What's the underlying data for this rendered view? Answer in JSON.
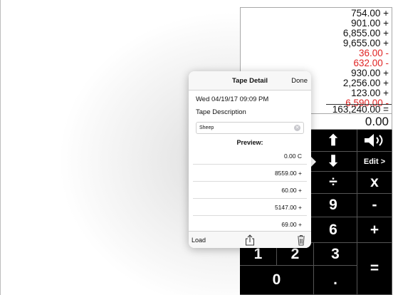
{
  "tape": {
    "lines": [
      {
        "value": "754.00 +",
        "negative": false
      },
      {
        "value": "901.00 +",
        "negative": false
      },
      {
        "value": "6,855.00 +",
        "negative": false
      },
      {
        "value": "9,655.00 +",
        "negative": false
      },
      {
        "value": "36.00 -",
        "negative": true
      },
      {
        "value": "632.00 -",
        "negative": true
      },
      {
        "value": "930.00 +",
        "negative": false
      },
      {
        "value": "2,256.00 +",
        "negative": false
      },
      {
        "value": "123.00 +",
        "negative": false
      },
      {
        "value": "6,590.00 -",
        "negative": true
      },
      {
        "value": "163,240.00 =",
        "negative": false
      }
    ],
    "negative_color": "#e02424"
  },
  "display": {
    "value": "0.00"
  },
  "keypad": {
    "up_arrow": "⬆",
    "down_arrow": "⬇",
    "sound": "🔊",
    "edit": "Edit >",
    "divide": "÷",
    "multiply": "x",
    "nine": "9",
    "minus": "-",
    "six": "6",
    "plus": "+",
    "one": "1",
    "two": "2",
    "three": "3",
    "equals": "=",
    "zero": "0",
    "decimal": "."
  },
  "popover": {
    "title": "Tape Detail",
    "done": "Done",
    "datetime": "Wed 04/19/17 09:09 PM",
    "description_label": "Tape Description",
    "description_value": "Sheep",
    "preview_label": "Preview:",
    "preview_rows": [
      "0.00 C",
      "8559.00 +",
      "60.00 +",
      "5147.00 +",
      "69.00 +"
    ],
    "load": "Load",
    "share_icon": "share-icon",
    "trash_icon": "trash-icon"
  }
}
